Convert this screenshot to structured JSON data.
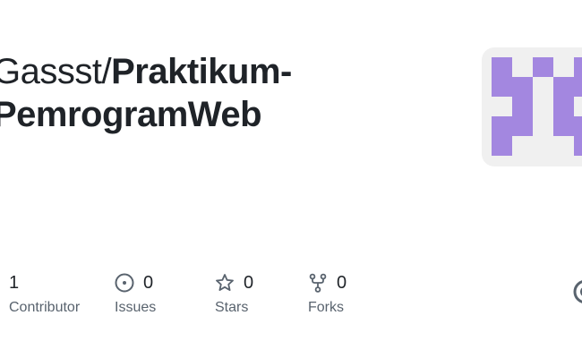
{
  "repo": {
    "owner": "Gassst",
    "separator": "/",
    "name": "Praktikum-PemrogramWeb"
  },
  "avatar": {
    "background": "#f0f0f0",
    "accent": "#a387e0"
  },
  "stats": {
    "contributors": {
      "count": "1",
      "label": "Contributor"
    },
    "issues": {
      "count": "0",
      "label": "Issues",
      "icon": "issue-open-icon"
    },
    "stars": {
      "count": "0",
      "label": "Stars",
      "icon": "star-icon"
    },
    "forks": {
      "count": "0",
      "label": "Forks",
      "icon": "repo-forked-icon"
    }
  },
  "colors": {
    "text_primary": "#1f2328",
    "text_muted": "#59636e",
    "icon": "#59636e"
  }
}
